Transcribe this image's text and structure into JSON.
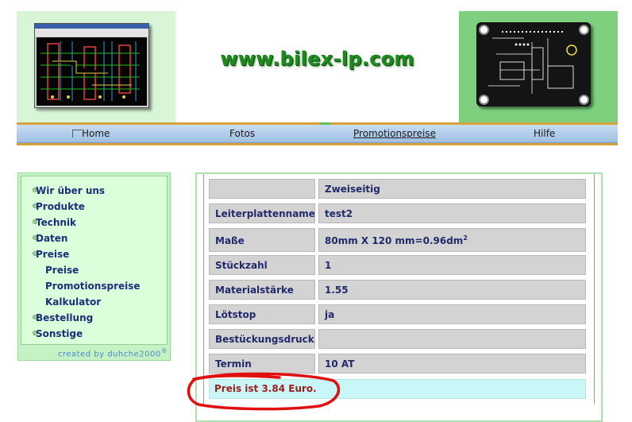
{
  "header": {
    "site_title": "www.bilex-lp.com"
  },
  "nav": {
    "items": [
      {
        "label": "Home"
      },
      {
        "label": "Fotos"
      },
      {
        "label": "Promotionspreise"
      },
      {
        "label": "Hilfe"
      }
    ]
  },
  "sidebar": {
    "items": [
      {
        "label": "Wir über uns"
      },
      {
        "label": "Produkte"
      },
      {
        "label": "Technik"
      },
      {
        "label": "Daten"
      },
      {
        "label": "Preise"
      },
      {
        "label": "Preise"
      },
      {
        "label": "Promotionspreise"
      },
      {
        "label": "Kalkulator"
      },
      {
        "label": "Bestellung"
      },
      {
        "label": "Sonstige"
      }
    ],
    "credit": "created by duhche2000",
    "credit_mark": "®"
  },
  "table": {
    "rows": [
      {
        "label": "",
        "value": "Zweiseitig"
      },
      {
        "label": "Leiterplattenname",
        "value": "test2"
      },
      {
        "label": "Maße",
        "value": "80mm X 120 mm=0.96dm",
        "value_sup": "2"
      },
      {
        "label": "Stückzahl",
        "value": "1"
      },
      {
        "label": "Materialstärke",
        "value": "1.55"
      },
      {
        "label": "Lötstop",
        "value": "ja"
      },
      {
        "label": "Bestückungsdruck",
        "value": ""
      },
      {
        "label": "Termin",
        "value": "10 AT"
      }
    ],
    "price": "Preis ist 3.84 Euro."
  },
  "colors": {
    "title_green": "#1f8a1f",
    "nav_gold": "#d5a23c",
    "sidebar_bg": "#dbffdb",
    "label_text": "#222a6a",
    "price_text": "#a02020",
    "circle_red": "#e01010"
  }
}
